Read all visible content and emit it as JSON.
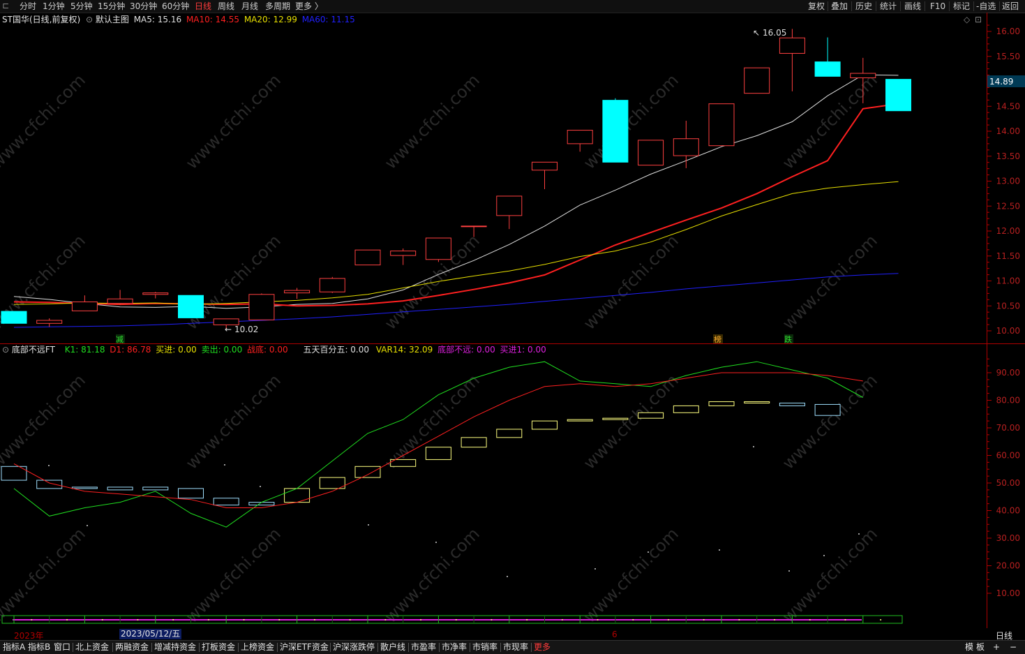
{
  "toolbar": {
    "icon": "bracket-icon",
    "periods": [
      "分时",
      "1分钟",
      "5分钟",
      "15分钟",
      "30分钟",
      "60分钟",
      "日线",
      "周线",
      "月线",
      "多周期",
      "更多 〉"
    ],
    "active_period": "日线",
    "right": [
      "复权",
      "叠加",
      "历史",
      "统计",
      "画线",
      "F10",
      "标记",
      "-自选",
      "返回"
    ]
  },
  "main_panel": {
    "title": "ST国华(日线,前复权)",
    "template": "默认主图",
    "ma": [
      {
        "label": "MA5: 15.16",
        "color": "#e0e0e0"
      },
      {
        "label": "MA10: 14.55",
        "color": "#ff2020"
      },
      {
        "label": "MA20: 12.99",
        "color": "#e8e000"
      },
      {
        "label": "MA60: 11.15",
        "color": "#2020ff"
      }
    ],
    "high_marker": "16.05",
    "low_marker": "10.02",
    "current_price": "14.89",
    "event_tags": [
      "减",
      "榜",
      "跌"
    ]
  },
  "sub_panel": {
    "title": "底部不远FT",
    "indicators": [
      {
        "label": "K1: 81.18",
        "color": "#20e020"
      },
      {
        "label": "D1: 86.78",
        "color": "#ff2020"
      },
      {
        "label": "买进: 0.00",
        "color": "#e8e000"
      },
      {
        "label": "卖出: 0.00",
        "color": "#20e020"
      },
      {
        "label": "战底: 0.00",
        "color": "#ff2020"
      },
      {
        "label": "五天百分五: 0.00",
        "color": "#e0e0e0"
      },
      {
        "label": "VAR14: 32.09",
        "color": "#e8e000"
      },
      {
        "label": "底部不远: 0.00",
        "color": "#e020e0"
      },
      {
        "label": "买进1: 0.00",
        "color": "#e020e0"
      }
    ]
  },
  "date_axis": {
    "year": "2023年",
    "cursor_date": "2023/05/12/五",
    "month_mark": "6",
    "period": "日线"
  },
  "bottom_tabs": [
    "指标A",
    "指标B",
    "窗口",
    "北上资金",
    "两融资金",
    "增减持资金",
    "打板资金",
    "上榜资金",
    "沪深ETF资金",
    "沪深涨跌停",
    "散户线",
    "市盈率",
    "市净率",
    "市销率",
    "市现率",
    "更多"
  ],
  "bottom_right": [
    "模",
    "板",
    "+",
    "−"
  ],
  "watermark": "www.cfchi.com",
  "chart_data": [
    {
      "type": "candlestick",
      "title": "ST国华(日线,前复权)",
      "ylim": [
        9.8,
        16.2
      ],
      "y_ticks": [
        10.0,
        10.5,
        11.0,
        11.5,
        12.0,
        12.5,
        13.0,
        13.5,
        14.0,
        14.5,
        15.0,
        15.5,
        16.0
      ],
      "candles": [
        {
          "o": 10.39,
          "h": 10.39,
          "l": 10.15,
          "c": 10.15
        },
        {
          "o": 10.15,
          "h": 10.25,
          "l": 10.08,
          "c": 10.21
        },
        {
          "o": 10.4,
          "h": 10.71,
          "l": 10.4,
          "c": 10.58
        },
        {
          "o": 10.55,
          "h": 10.82,
          "l": 10.52,
          "c": 10.64
        },
        {
          "o": 10.73,
          "h": 10.78,
          "l": 10.65,
          "c": 10.76
        },
        {
          "o": 10.71,
          "h": 10.71,
          "l": 10.26,
          "c": 10.26
        },
        {
          "o": 10.12,
          "h": 10.24,
          "l": 10.02,
          "c": 10.24
        },
        {
          "o": 10.22,
          "h": 10.75,
          "l": 10.22,
          "c": 10.73
        },
        {
          "o": 10.76,
          "h": 10.86,
          "l": 10.64,
          "c": 10.81
        },
        {
          "o": 10.78,
          "h": 11.08,
          "l": 10.76,
          "c": 11.05
        },
        {
          "o": 11.32,
          "h": 11.62,
          "l": 11.32,
          "c": 11.62
        },
        {
          "o": 11.51,
          "h": 11.65,
          "l": 11.32,
          "c": 11.6
        },
        {
          "o": 11.43,
          "h": 11.86,
          "l": 11.38,
          "c": 11.86
        },
        {
          "o": 12.1,
          "h": 12.1,
          "l": 11.88,
          "c": 12.1
        },
        {
          "o": 12.31,
          "h": 12.7,
          "l": 12.04,
          "c": 12.7
        },
        {
          "o": 13.22,
          "h": 13.38,
          "l": 12.84,
          "c": 13.38
        },
        {
          "o": 13.75,
          "h": 14.02,
          "l": 13.59,
          "c": 14.02
        },
        {
          "o": 14.62,
          "h": 14.66,
          "l": 13.38,
          "c": 13.38
        },
        {
          "o": 13.32,
          "h": 13.82,
          "l": 13.32,
          "c": 13.82
        },
        {
          "o": 13.51,
          "h": 14.21,
          "l": 13.26,
          "c": 13.85
        },
        {
          "o": 13.71,
          "h": 14.55,
          "l": 13.71,
          "c": 14.55
        },
        {
          "o": 14.76,
          "h": 15.27,
          "l": 14.76,
          "c": 15.27
        },
        {
          "o": 15.56,
          "h": 16.05,
          "l": 14.8,
          "c": 15.87
        },
        {
          "o": 15.39,
          "h": 15.88,
          "l": 15.1,
          "c": 15.1
        },
        {
          "o": 15.07,
          "h": 15.47,
          "l": 14.56,
          "c": 15.16
        },
        {
          "o": 15.04,
          "h": 15.04,
          "l": 14.41,
          "c": 14.41
        }
      ],
      "series": [
        {
          "name": "MA5",
          "color": "#e0e0e0",
          "values": [
            10.69,
            10.63,
            10.55,
            10.48,
            10.47,
            10.49,
            10.45,
            10.48,
            10.53,
            10.55,
            10.64,
            10.82,
            11.13,
            11.41,
            11.73,
            12.1,
            12.52,
            12.82,
            13.14,
            13.41,
            13.69,
            13.91,
            14.19,
            14.71,
            15.13,
            15.12
          ]
        },
        {
          "name": "MA10",
          "color": "#ff2020",
          "values": [
            10.58,
            10.57,
            10.55,
            10.53,
            10.55,
            10.54,
            10.53,
            10.54,
            10.5,
            10.51,
            10.54,
            10.6,
            10.71,
            10.83,
            10.96,
            11.12,
            11.42,
            11.72,
            11.97,
            12.22,
            12.46,
            12.75,
            13.09,
            13.41,
            14.45,
            14.55
          ]
        },
        {
          "name": "MA20",
          "color": "#e8e000",
          "values": [
            10.53,
            10.54,
            10.56,
            10.55,
            10.56,
            10.53,
            10.55,
            10.58,
            10.61,
            10.66,
            10.73,
            10.86,
            10.99,
            11.1,
            11.2,
            11.33,
            11.49,
            11.6,
            11.78,
            12.03,
            12.3,
            12.53,
            12.75,
            12.86,
            12.93,
            12.99
          ]
        },
        {
          "name": "MA60",
          "color": "#2020ff",
          "values": [
            10.07,
            10.08,
            10.09,
            10.1,
            10.12,
            10.15,
            10.18,
            10.21,
            10.24,
            10.28,
            10.33,
            10.38,
            10.43,
            10.48,
            10.53,
            10.59,
            10.65,
            10.71,
            10.77,
            10.84,
            10.9,
            10.96,
            11.02,
            11.08,
            11.12,
            11.15
          ]
        }
      ]
    },
    {
      "type": "line",
      "title": "底部不远FT",
      "ylim": [
        0,
        100
      ],
      "y_ticks": [
        10,
        20,
        30,
        40,
        50,
        60,
        70,
        80,
        90
      ],
      "series": [
        {
          "name": "K1",
          "color": "#20e020",
          "values": [
            48,
            38,
            41,
            43,
            47,
            39,
            34,
            43,
            48,
            58,
            68,
            73,
            82,
            88,
            92,
            94,
            87,
            86,
            85,
            89,
            92,
            94,
            91,
            88,
            81
          ]
        },
        {
          "name": "D1",
          "color": "#ff2020",
          "values": [
            57,
            50,
            47,
            46,
            45,
            44,
            41,
            41,
            43,
            47,
            53,
            60,
            67,
            74,
            80,
            85,
            86,
            85,
            86,
            88,
            90,
            90,
            90,
            89,
            87
          ]
        }
      ],
      "boxes": [
        {
          "low": 51,
          "high": 56
        },
        {
          "low": 48,
          "high": 51
        },
        {
          "low": 48,
          "high": 48.5
        },
        {
          "low": 47.5,
          "high": 48.5
        },
        {
          "low": 47.5,
          "high": 48.5
        },
        {
          "low": 44.5,
          "high": 48
        },
        {
          "low": 42,
          "high": 44.5
        },
        {
          "low": 42,
          "high": 43
        },
        {
          "low": 43,
          "high": 48
        },
        {
          "low": 48,
          "high": 52
        },
        {
          "low": 52,
          "high": 56
        },
        {
          "low": 56,
          "high": 58.5
        },
        {
          "low": 58.5,
          "high": 63
        },
        {
          "low": 63,
          "high": 66.5
        },
        {
          "low": 66.5,
          "high": 69.5
        },
        {
          "low": 69.5,
          "high": 72.5
        },
        {
          "low": 72.5,
          "high": 73
        },
        {
          "low": 73,
          "high": 73.5
        },
        {
          "low": 73.5,
          "high": 75.5
        },
        {
          "low": 75.5,
          "high": 78
        },
        {
          "low": 78,
          "high": 79.5
        },
        {
          "low": 79.5,
          "high": 79.5
        },
        {
          "low": 78,
          "high": 79
        },
        {
          "low": 74.5,
          "high": 78.5
        }
      ]
    }
  ]
}
